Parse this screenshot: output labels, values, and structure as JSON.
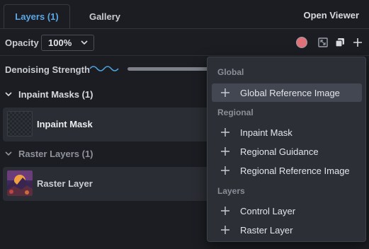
{
  "tabs": {
    "layers": "Layers (1)",
    "gallery": "Gallery"
  },
  "header": {
    "open_viewer": "Open Viewer"
  },
  "toolbar": {
    "opacity_label": "Opacity",
    "opacity_value": "100%",
    "swatch_color": "#e07178"
  },
  "denoise": {
    "label": "Denoising Strength"
  },
  "groups": {
    "inpaint": {
      "title": "Inpaint Masks (1)",
      "item": "Inpaint Mask"
    },
    "raster": {
      "title": "Raster Layers (1)",
      "item": "Raster Layer"
    }
  },
  "menu": {
    "global_heading": "Global",
    "global_ref": "Global Reference Image",
    "regional_heading": "Regional",
    "inpaint_mask": "Inpaint Mask",
    "regional_guidance": "Regional Guidance",
    "regional_ref": "Regional Reference Image",
    "layers_heading": "Layers",
    "control_layer": "Control Layer",
    "raster_layer": "Raster Layer"
  }
}
